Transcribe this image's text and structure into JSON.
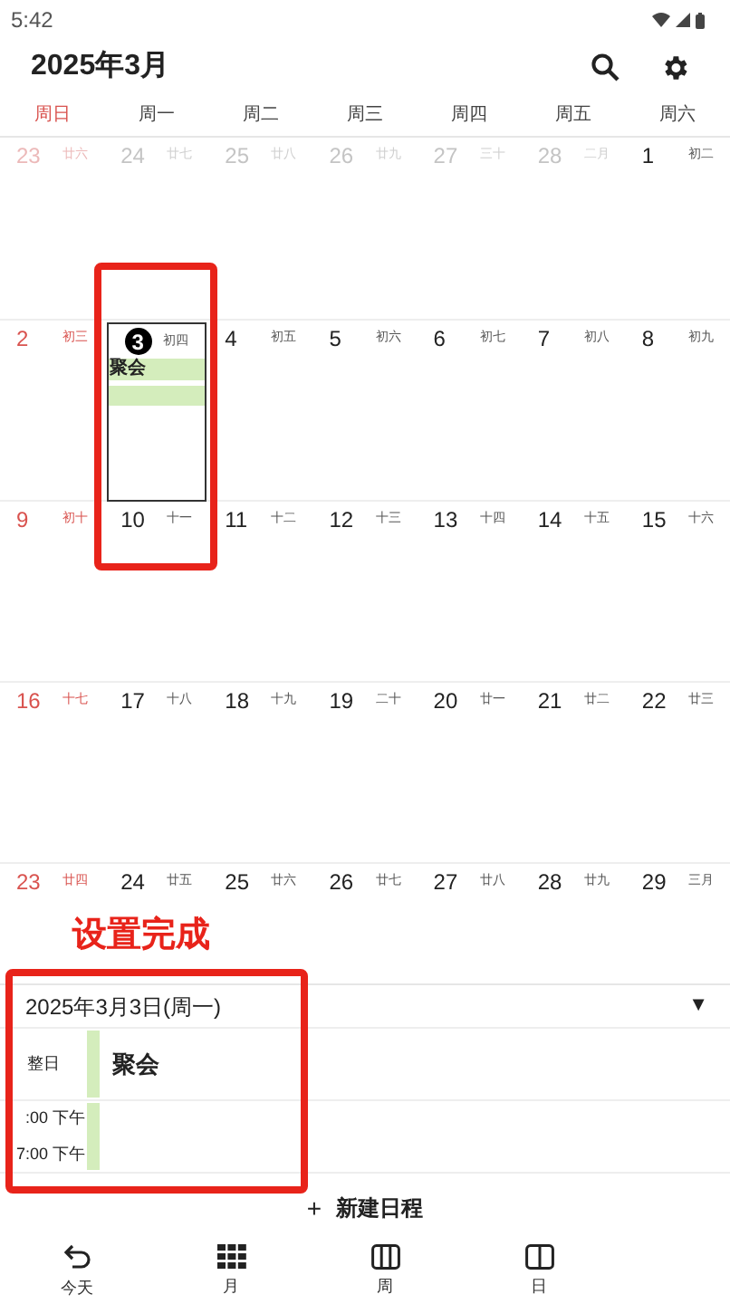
{
  "status_bar": {
    "time": "5:42"
  },
  "header": {
    "title": "2025年3月"
  },
  "weekdays": [
    "周日",
    "周一",
    "周二",
    "周三",
    "周四",
    "周五",
    "周六"
  ],
  "weeks": [
    [
      {
        "day": "23",
        "lunar": "廿六",
        "in_month": false,
        "selected": false
      },
      {
        "day": "24",
        "lunar": "廿七",
        "in_month": false,
        "selected": false
      },
      {
        "day": "25",
        "lunar": "廿八",
        "in_month": false,
        "selected": false
      },
      {
        "day": "26",
        "lunar": "廿九",
        "in_month": false,
        "selected": false
      },
      {
        "day": "27",
        "lunar": "三十",
        "in_month": false,
        "selected": false
      },
      {
        "day": "28",
        "lunar": "二月",
        "in_month": false,
        "selected": false
      },
      {
        "day": "1",
        "lunar": "初二",
        "in_month": true,
        "selected": false
      }
    ],
    [
      {
        "day": "2",
        "lunar": "初三",
        "in_month": true,
        "selected": false
      },
      {
        "day": "3",
        "lunar": "初四",
        "in_month": true,
        "selected": true,
        "events": [
          {
            "kind": "titled",
            "title": "聚会"
          },
          {
            "kind": "untitled"
          }
        ]
      },
      {
        "day": "4",
        "lunar": "初五",
        "in_month": true,
        "selected": false
      },
      {
        "day": "5",
        "lunar": "初六",
        "in_month": true,
        "selected": false
      },
      {
        "day": "6",
        "lunar": "初七",
        "in_month": true,
        "selected": false
      },
      {
        "day": "7",
        "lunar": "初八",
        "in_month": true,
        "selected": false
      },
      {
        "day": "8",
        "lunar": "初九",
        "in_month": true,
        "selected": false
      }
    ],
    [
      {
        "day": "9",
        "lunar": "初十",
        "in_month": true,
        "selected": false
      },
      {
        "day": "10",
        "lunar": "十一",
        "in_month": true,
        "selected": false
      },
      {
        "day": "11",
        "lunar": "十二",
        "in_month": true,
        "selected": false
      },
      {
        "day": "12",
        "lunar": "十三",
        "in_month": true,
        "selected": false
      },
      {
        "day": "13",
        "lunar": "十四",
        "in_month": true,
        "selected": false
      },
      {
        "day": "14",
        "lunar": "十五",
        "in_month": true,
        "selected": false
      },
      {
        "day": "15",
        "lunar": "十六",
        "in_month": true,
        "selected": false
      }
    ],
    [
      {
        "day": "16",
        "lunar": "十七",
        "in_month": true,
        "selected": false
      },
      {
        "day": "17",
        "lunar": "十八",
        "in_month": true,
        "selected": false
      },
      {
        "day": "18",
        "lunar": "十九",
        "in_month": true,
        "selected": false
      },
      {
        "day": "19",
        "lunar": "二十",
        "in_month": true,
        "selected": false
      },
      {
        "day": "20",
        "lunar": "廿一",
        "in_month": true,
        "selected": false
      },
      {
        "day": "21",
        "lunar": "廿二",
        "in_month": true,
        "selected": false
      },
      {
        "day": "22",
        "lunar": "廿三",
        "in_month": true,
        "selected": false
      }
    ],
    [
      {
        "day": "23",
        "lunar": "廿四",
        "in_month": true,
        "selected": false
      },
      {
        "day": "24",
        "lunar": "廿五",
        "in_month": true,
        "selected": false
      },
      {
        "day": "25",
        "lunar": "廿六",
        "in_month": true,
        "selected": false
      },
      {
        "day": "26",
        "lunar": "廿七",
        "in_month": true,
        "selected": false
      },
      {
        "day": "27",
        "lunar": "廿八",
        "in_month": true,
        "selected": false
      },
      {
        "day": "28",
        "lunar": "廿九",
        "in_month": true,
        "selected": false
      },
      {
        "day": "29",
        "lunar": "三月",
        "in_month": true,
        "selected": false
      }
    ]
  ],
  "annotation": {
    "label": "设置完成"
  },
  "detail": {
    "date": "2025年3月3日(周一)",
    "toggle": "▼",
    "rows": [
      {
        "kind": "allday",
        "label": "整日",
        "title": "聚会"
      },
      {
        "kind": "timed",
        "times": [
          ":00 下午",
          "7:00 下午"
        ]
      }
    ]
  },
  "new_event": {
    "icon": "+",
    "label": "新建日程"
  },
  "bottom_nav": [
    {
      "kind": "today",
      "label": "今天"
    },
    {
      "kind": "month",
      "label": "月"
    },
    {
      "kind": "week",
      "label": "周"
    },
    {
      "kind": "day",
      "label": "日"
    }
  ]
}
